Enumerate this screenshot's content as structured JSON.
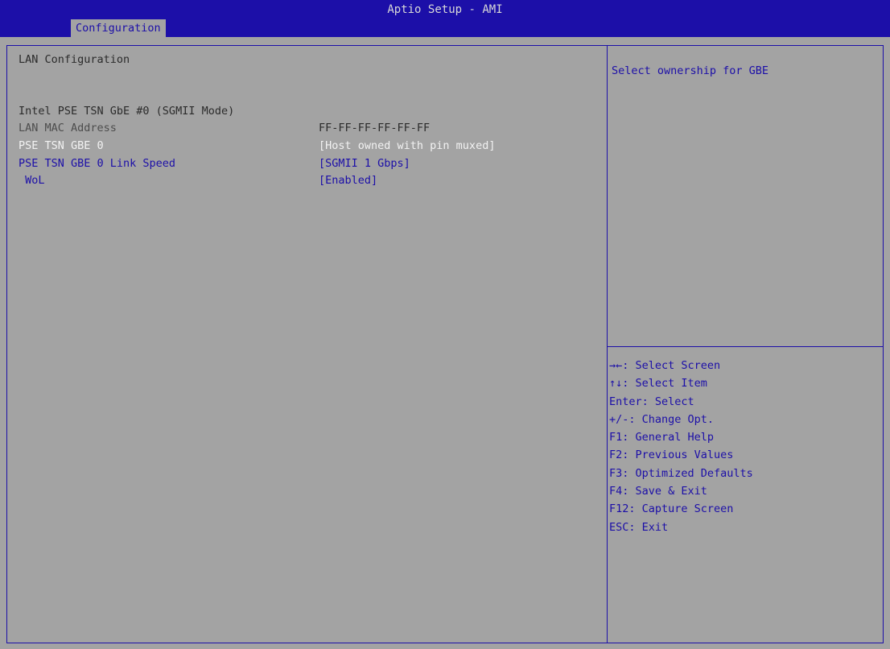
{
  "app_title": "Aptio Setup - AMI",
  "tabs": [
    {
      "label": "Configuration",
      "active": true
    }
  ],
  "page_title": "LAN Configuration",
  "section_title": "Intel PSE TSN GbE #0 (SGMII Mode)",
  "settings": [
    {
      "label": "LAN MAC Address",
      "value": "FF-FF-FF-FF-FF-FF"
    },
    {
      "label": "PSE TSN GBE 0",
      "value": "[Host owned with pin muxed]"
    },
    {
      "label": "PSE TSN GBE 0 Link Speed",
      "value": "[SGMII 1 Gbps]"
    },
    {
      "label": " WoL",
      "value": "[Enabled]"
    }
  ],
  "help": {
    "description": "Select ownership for GBE"
  },
  "keys": [
    "→←: Select Screen",
    "↑↓: Select Item",
    "Enter: Select",
    "+/-: Change Opt.",
    "F1: General Help",
    "F2: Previous Values",
    "F3: Optimized Defaults",
    "F4: Save & Exit",
    "F12: Capture Screen",
    "ESC: Exit"
  ],
  "colors": {
    "background": "#a3a3a3",
    "header": "#1c0fa8",
    "accent": "#1c0fa8",
    "selected_text": "#f2f2f2"
  }
}
